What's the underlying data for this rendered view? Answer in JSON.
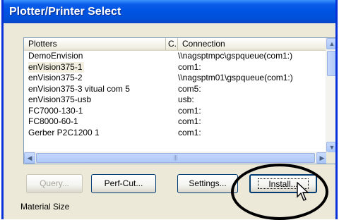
{
  "window": {
    "title": "Plotter/Printer Select"
  },
  "plotters": {
    "columns": [
      "Plotters",
      "C.",
      "Connection"
    ],
    "rows": [
      {
        "name": "DemoEnvision",
        "connection": "\\\\nagsptmpc\\gspqueue(com1:)"
      },
      {
        "name": "enVision375-1",
        "connection": "com1:",
        "selected": true
      },
      {
        "name": "enVision375-2",
        "connection": "\\\\nagsptm01\\gspqueue(com1:)"
      },
      {
        "name": "enVision375-3 vitual com 5",
        "connection": "com5:"
      },
      {
        "name": "enVision375-usb",
        "connection": "usb:"
      },
      {
        "name": "FC7000-130-1",
        "connection": "com1:"
      },
      {
        "name": "FC8000-60-1",
        "connection": "com1:"
      },
      {
        "name": "Gerber P2C1200 1",
        "connection": "com1:"
      }
    ]
  },
  "buttons": {
    "query": "Query...",
    "perf_cut": "Perf-Cut...",
    "settings": "Settings...",
    "install": "Install..."
  },
  "groupbox": {
    "material_size": "Material Size"
  }
}
